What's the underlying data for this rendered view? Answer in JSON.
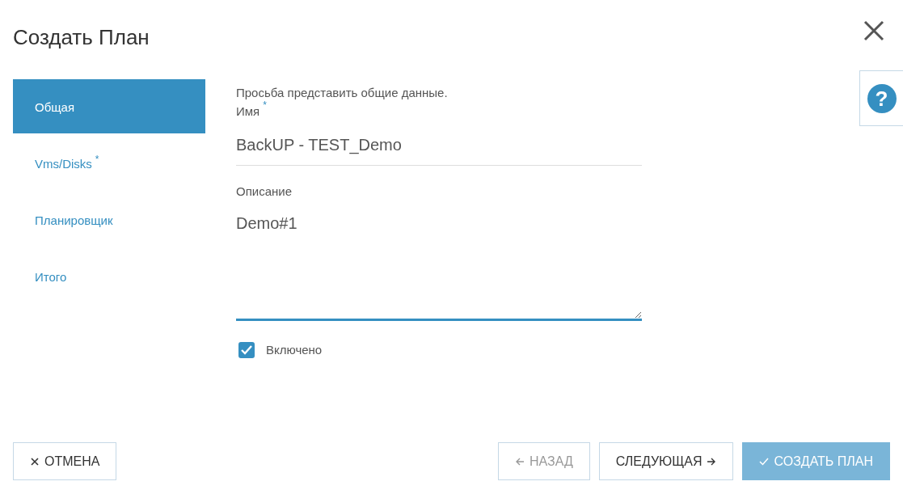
{
  "title": "Создать План",
  "help": {
    "label": "?"
  },
  "steps": [
    {
      "label": "Общая",
      "selected": true
    },
    {
      "label": "Vms/Disks",
      "required_mark": "*",
      "selected": false
    },
    {
      "label": "Планировщик",
      "selected": false
    },
    {
      "label": "Итого",
      "selected": false
    }
  ],
  "intro": "Просьба представить общие данные.",
  "name_field": {
    "label": "Имя",
    "required_mark": "*",
    "value": "BackUP - TEST_Demo"
  },
  "description_field": {
    "label": "Описание",
    "value": "Demo#1"
  },
  "enabled": {
    "label": "Включено",
    "checked": true
  },
  "buttons": [
    {
      "kind": "cancel",
      "label": "ОТМЕНА",
      "disabled": false
    },
    {
      "kind": "back",
      "label": "НАЗАД",
      "disabled": true
    },
    {
      "kind": "next",
      "label": "СЛЕДУЮЩАЯ",
      "disabled": false
    },
    {
      "kind": "create",
      "label": "СОЗДАТЬ ПЛАН",
      "disabled": true
    }
  ]
}
